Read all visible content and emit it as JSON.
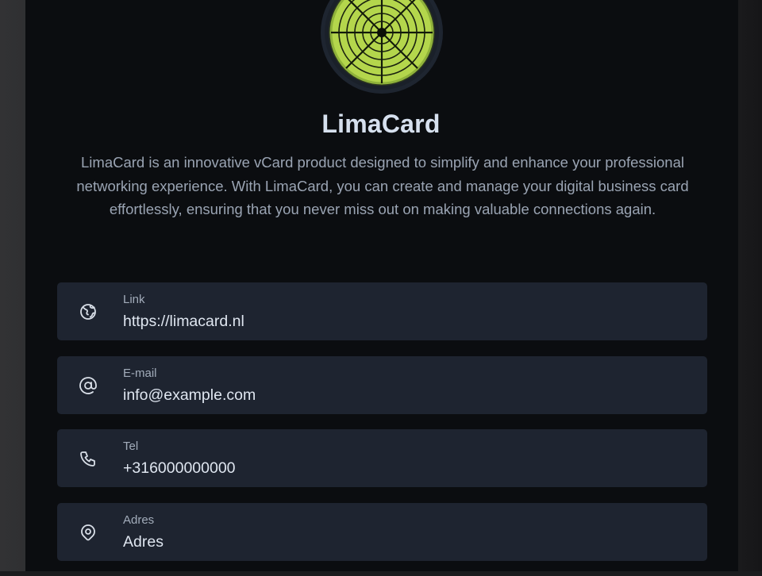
{
  "profile": {
    "title": "LimaCard",
    "description": "LimaCard is an innovative vCard product designed to simplify and enhance your professional networking experience. With LimaCard, you can create and manage your digital business card effortlessly, ensuring that you never miss out on making valuable connections again.",
    "avatar_icon": "lime-slice-logo"
  },
  "contacts": [
    {
      "label": "Link",
      "value": "https://limacard.nl",
      "icon": "globe-icon"
    },
    {
      "label": "E-mail",
      "value": "info@example.com",
      "icon": "at-sign-icon"
    },
    {
      "label": "Tel",
      "value": "+316000000000",
      "icon": "phone-icon"
    },
    {
      "label": "Adres",
      "value": "Adres",
      "icon": "map-pin-icon"
    }
  ],
  "colors": {
    "background": "#0b0d10",
    "field_background": "#1e2430",
    "accent_lime": "#b5d94f",
    "title": "#d6e0ee"
  }
}
